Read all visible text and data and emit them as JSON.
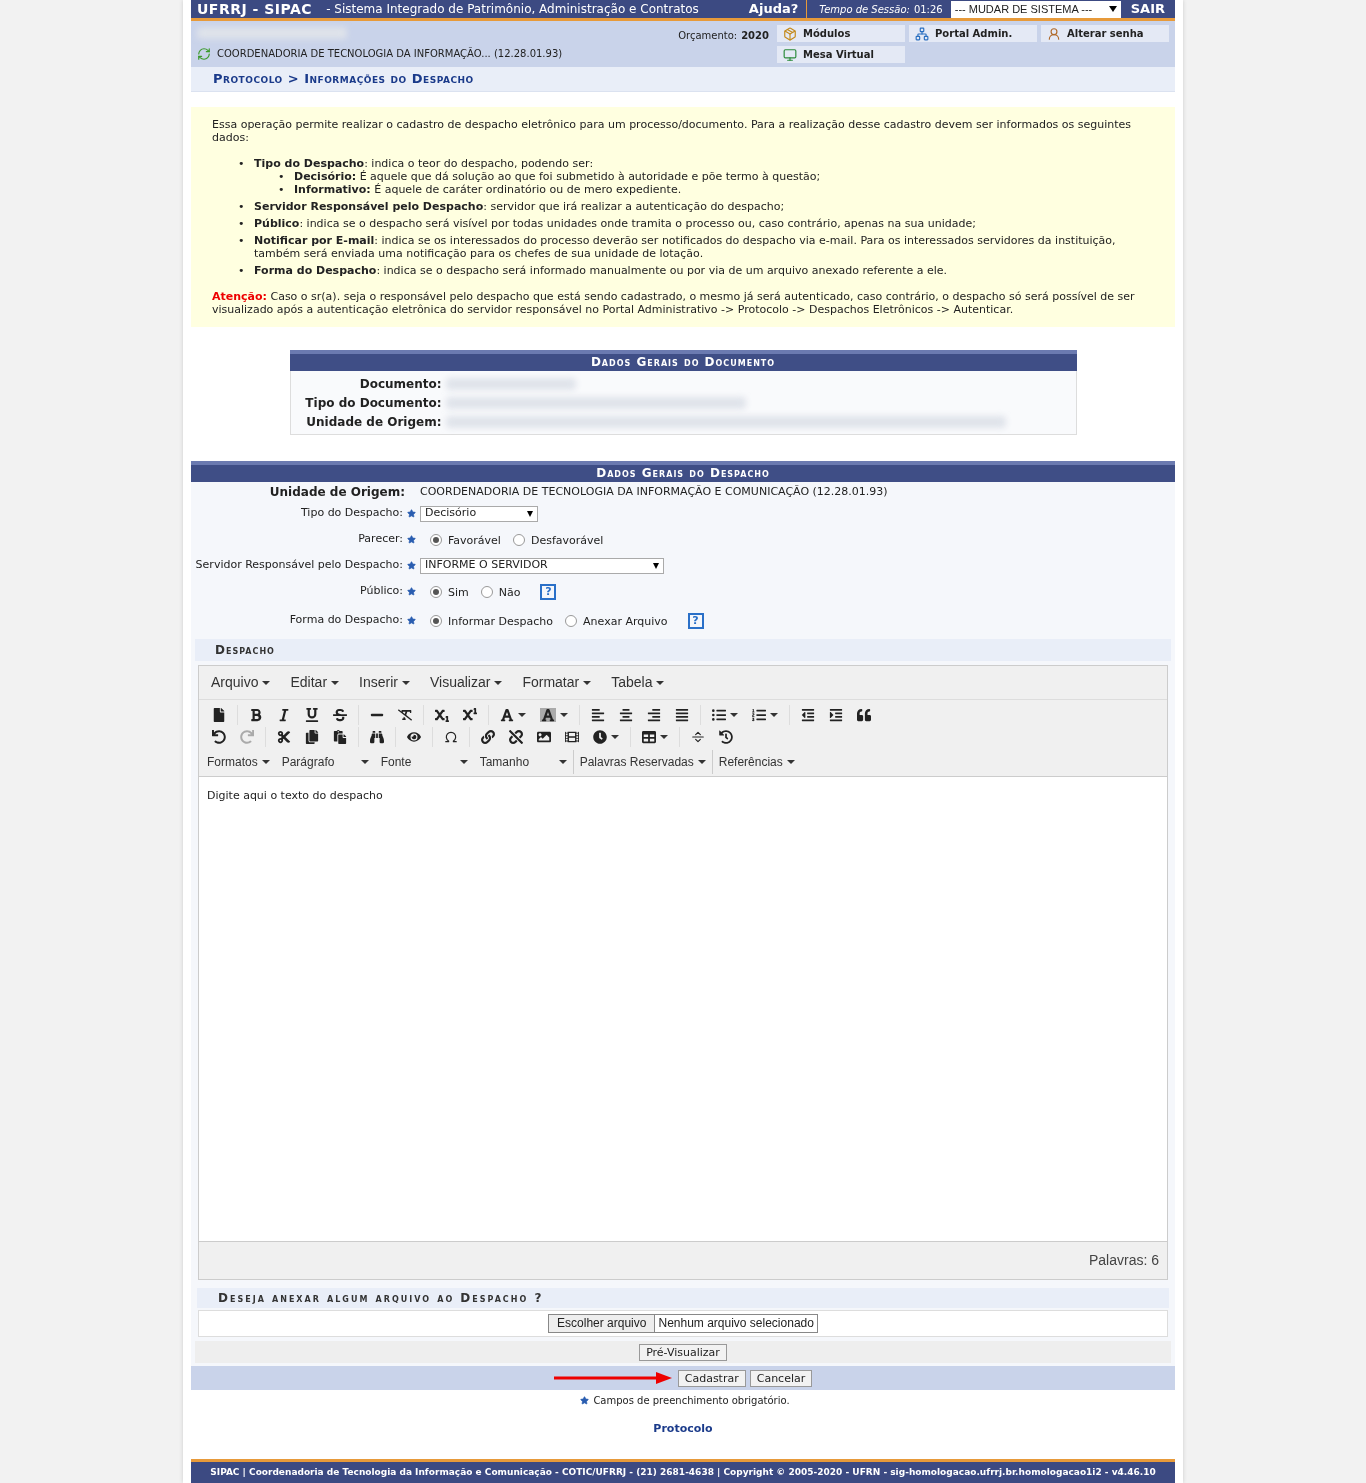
{
  "header": {
    "brand": "UFRRJ - SIPAC",
    "subtitle": "- Sistema Integrado de Patrimônio, Administração e Contratos",
    "help": "Ajuda?",
    "session_label": "Tempo de Sessão:",
    "session_time": "01:26",
    "system_select": "--- MUDAR DE SISTEMA ---",
    "logout": "SAIR"
  },
  "info_bar": {
    "unit": "COORDENADORIA DE TECNOLOGIA DA INFORMAÇÃO... (12.28.01.93)",
    "budget_label": "Orçamento:",
    "budget_year": "2020",
    "shortcuts": [
      {
        "kind": "modules",
        "label": "Módulos"
      },
      {
        "kind": "portal",
        "label": "Portal Admin."
      },
      {
        "kind": "password",
        "label": "Alterar senha"
      },
      {
        "kind": "desk",
        "label": "Mesa Virtual"
      }
    ]
  },
  "breadcrumb": "Protocolo > Informações do Despacho",
  "notice": {
    "intro": "Essa operação permite realizar o cadastro de despacho eletrônico para um processo/documento. Para a realização desse cadastro devem ser informados os seguintes dados:",
    "items": [
      {
        "marker": "•",
        "text": "**Tipo do Despacho**: indica o teor do despacho, podendo ser:",
        "children": [
          {
            "marker": "•",
            "text": "**Decisório:** É aquele que dá solução ao que foi submetido à autoridade e põe termo à questão;"
          },
          {
            "marker": "•",
            "text": "**Informativo:** É aquele de caráter ordinatório ou de mero expediente."
          }
        ]
      },
      {
        "marker": "•",
        "text": "**Servidor Responsável pelo Despacho**: servidor que irá realizar a autenticação do despacho;"
      },
      {
        "marker": "•",
        "text": "**Público**: indica se o despacho será visível por todas unidades onde tramita o processo ou, caso contrário, apenas na sua unidade;"
      },
      {
        "marker": "•",
        "text": "**Notificar por E-mail**: indica se os interessados do processo deverão ser notificados do despacho via e-mail. Para os interessados servidores da instituição, também será enviada uma notificação para os chefes de sua unidade de lotação."
      },
      {
        "marker": "•",
        "text": "**Forma do Despacho**: indica se o despacho será informado manualmente ou por via de um arquivo anexado referente a ele."
      }
    ],
    "warning_label": "Atenção:",
    "warning": "Caso o sr(a). seja o responsável pelo despacho que está sendo cadastrado, o mesmo já será autenticado, caso contrário, o despacho só será possível de ser visualizado após a autenticação eletrônica do servidor responsável no Portal Administrativo -> Protocolo -> Despachos Eletrônicos -> Autenticar."
  },
  "document": {
    "title": "Dados Gerais do Documento",
    "fields": [
      "Documento:",
      "Tipo do Documento:",
      "Unidade de Origem:"
    ]
  },
  "dispatch": {
    "title": "Dados Gerais do Despacho",
    "origin_label": "Unidade de Origem:",
    "origin_value": "COORDENADORIA DE TECNOLOGIA DA INFORMAÇÃO E COMUNICAÇÃO (12.28.01.93)",
    "rows": [
      {
        "kind": "select",
        "label": "Tipo do Despacho:",
        "value": "Decisório",
        "wide": false
      },
      {
        "kind": "radio",
        "label": "Parecer:",
        "options": [
          {
            "label": "Favorável",
            "selected": true
          },
          {
            "label": "Desfavorável",
            "selected": false
          }
        ]
      },
      {
        "kind": "select",
        "label": "Servidor Responsável pelo Despacho:",
        "value": "INFORME O SERVIDOR",
        "wide": true
      },
      {
        "kind": "radio",
        "label": "Público:",
        "options": [
          {
            "label": "Sim",
            "selected": true
          },
          {
            "label": "Não",
            "selected": false
          }
        ],
        "help": "?"
      },
      {
        "kind": "radio",
        "label": "Forma do Despacho:",
        "options": [
          {
            "label": "Informar Despacho",
            "selected": true
          },
          {
            "label": "Anexar Arquivo",
            "selected": false
          }
        ],
        "help": "?"
      }
    ]
  },
  "editor": {
    "section": "Despacho",
    "menus": [
      "Arquivo",
      "Editar",
      "Inserir",
      "Visualizar",
      "Formatar",
      "Tabela"
    ],
    "dropdowns": [
      {
        "label": "Formatos",
        "kind": "menu"
      },
      {
        "label": "Parágrafo",
        "kind": "select"
      },
      {
        "label": "Fonte",
        "kind": "select"
      },
      {
        "label": "Tamanho",
        "kind": "select"
      },
      {
        "label": "Palavras Reservadas",
        "kind": "menu"
      },
      {
        "label": "Referências",
        "kind": "menu"
      }
    ],
    "placeholder": "Digite aqui o texto do despacho",
    "word_count": "Palavras: 6"
  },
  "attachment": {
    "title": "Deseja anexar algum arquivo ao Despacho ?",
    "choose": "Escolher arquivo",
    "no_file": "Nenhum arquivo selecionado"
  },
  "preview": "Pré-Visualizar",
  "actions": [
    "Cadastrar",
    "Cancelar"
  ],
  "required_note": "Campos de preenchimento obrigatório.",
  "module_link": "Protocolo",
  "footer": "SIPAC | Coordenadoria de Tecnologia da Informação e Comunicação - COTIC/UFRRJ - (21) 2681-4638 | Copyright © 2005-2020 - UFRN - sig-homologacao.ufrrj.br.homologacao1i2 - v4.46.10"
}
